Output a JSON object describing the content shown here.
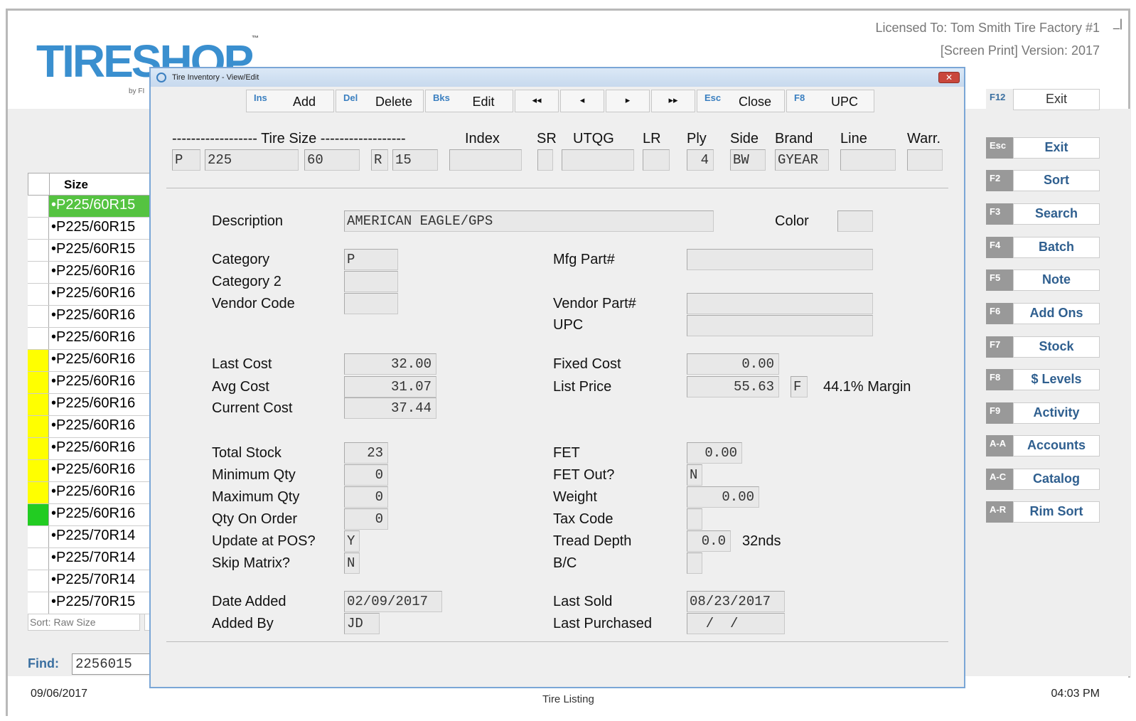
{
  "header": {
    "logo_text": "TIRESHOP",
    "logo_tm": "™",
    "logo_by": "by FI",
    "licensed": "Licensed To: Tom Smith Tire Factory #1",
    "screen_print": "[Screen Print]   Version: 2017",
    "minimize": "_|"
  },
  "status": {
    "date": "09/06/2017",
    "time": "04:03 PM",
    "center_label": "Tire Listing"
  },
  "list": {
    "header": "Size",
    "rows": [
      {
        "value": "•P225/60R15",
        "mark": "none",
        "selected": true
      },
      {
        "value": "•P225/60R15",
        "mark": "none"
      },
      {
        "value": "•P225/60R15",
        "mark": "none"
      },
      {
        "value": "•P225/60R16",
        "mark": "none"
      },
      {
        "value": "•P225/60R16",
        "mark": "none"
      },
      {
        "value": "•P225/60R16",
        "mark": "none"
      },
      {
        "value": "•P225/60R16",
        "mark": "none"
      },
      {
        "value": "•P225/60R16",
        "mark": "yellow"
      },
      {
        "value": "•P225/60R16",
        "mark": "yellow"
      },
      {
        "value": "•P225/60R16",
        "mark": "yellow"
      },
      {
        "value": "•P225/60R16",
        "mark": "yellow"
      },
      {
        "value": "•P225/60R16",
        "mark": "yellow"
      },
      {
        "value": "•P225/60R16",
        "mark": "yellow"
      },
      {
        "value": "•P225/60R16",
        "mark": "yellow"
      },
      {
        "value": "•P225/60R16",
        "mark": "green"
      },
      {
        "value": "•P225/70R14",
        "mark": "none"
      },
      {
        "value": "•P225/70R14",
        "mark": "none"
      },
      {
        "value": "•P225/70R14",
        "mark": "none"
      },
      {
        "value": "•P225/70R15",
        "mark": "none"
      }
    ],
    "sort_label": "Sort: Raw Size",
    "find_label": "Find:",
    "find_value": "2256015"
  },
  "fkeys": [
    {
      "key": "F12",
      "label": "Exit",
      "plain": true
    },
    {
      "key": "Esc",
      "label": "Exit"
    },
    {
      "key": "F2",
      "label": "Sort"
    },
    {
      "key": "F3",
      "label": "Search"
    },
    {
      "key": "F4",
      "label": "Batch"
    },
    {
      "key": "F5",
      "label": "Note"
    },
    {
      "key": "F6",
      "label": "Add Ons"
    },
    {
      "key": "F7",
      "label": "Stock"
    },
    {
      "key": "F8",
      "label": "$ Levels"
    },
    {
      "key": "F9",
      "label": "Activity"
    },
    {
      "key": "A-A",
      "label": "Accounts"
    },
    {
      "key": "A-C",
      "label": "Catalog"
    },
    {
      "key": "A-R",
      "label": "Rim Sort"
    }
  ],
  "dialog": {
    "title": "Tire Inventory - View/Edit",
    "close": "✕",
    "toolbar": [
      {
        "key": "Ins",
        "label": "Add"
      },
      {
        "key": "Del",
        "label": "Delete"
      },
      {
        "key": "Bks",
        "label": "Edit"
      },
      {
        "key": "",
        "label": "◂◂"
      },
      {
        "key": "",
        "label": "◂"
      },
      {
        "key": "",
        "label": "▸"
      },
      {
        "key": "",
        "label": "▸▸"
      },
      {
        "key": "Esc",
        "label": "Close"
      },
      {
        "key": "F8",
        "label": "UPC"
      }
    ],
    "size_header": {
      "tire_size": "------------------ Tire Size ------------------",
      "index": "Index",
      "sr": "SR",
      "utqg": "UTQG",
      "lr": "LR",
      "ply": "Ply",
      "side": "Side",
      "brand": "Brand",
      "line": "Line",
      "warr": "Warr."
    },
    "size_values": {
      "prefix": "P",
      "width": "225",
      "aspect": "60",
      "construction": "R",
      "rim": "15",
      "index": "",
      "sr": "",
      "utqg": "",
      "lr": "",
      "ply": "4",
      "side": "BW",
      "brand": "GYEAR",
      "line": "",
      "warr": ""
    },
    "fields": {
      "description_label": "Description",
      "description": "AMERICAN EAGLE/GPS",
      "color_label": "Color",
      "color": "",
      "category_label": "Category",
      "category": "P",
      "category2_label": "Category 2",
      "category2": "",
      "vendor_code_label": "Vendor Code",
      "vendor_code": "",
      "mfg_part_label": "Mfg Part#",
      "mfg_part": "",
      "vendor_part_label": "Vendor Part#",
      "vendor_part": "",
      "upc_label": "UPC",
      "upc": "",
      "last_cost_label": "Last Cost",
      "last_cost": "32.00",
      "avg_cost_label": "Avg Cost",
      "avg_cost": "31.07",
      "current_cost_label": "Current Cost",
      "current_cost": "37.44",
      "fixed_cost_label": "Fixed Cost",
      "fixed_cost": "0.00",
      "list_price_label": "List Price",
      "list_price": "55.63",
      "list_price_flag": "F",
      "margin": "44.1% Margin",
      "total_stock_label": "Total Stock",
      "total_stock": "23",
      "min_qty_label": "Minimum Qty",
      "min_qty": "0",
      "max_qty_label": "Maximum Qty",
      "max_qty": "0",
      "qty_order_label": "Qty On Order",
      "qty_order": "0",
      "update_pos_label": "Update at POS?",
      "update_pos": "Y",
      "skip_matrix_label": "Skip Matrix?",
      "skip_matrix": "N",
      "fet_label": "FET",
      "fet": "0.00",
      "fet_out_label": "FET Out?",
      "fet_out": "N",
      "weight_label": "Weight",
      "weight": "0.00",
      "tax_code_label": "Tax Code",
      "tax_code": "",
      "tread_label": "Tread Depth",
      "tread": "0.0",
      "tread_unit": "32nds",
      "bc_label": "B/C",
      "bc": "",
      "date_added_label": "Date Added",
      "date_added": "02/09/2017",
      "added_by_label": "Added By",
      "added_by": "JD",
      "last_sold_label": "Last Sold",
      "last_sold": "08/23/2017",
      "last_purchased_label": "Last Purchased",
      "last_purchased": "  /  /"
    }
  }
}
